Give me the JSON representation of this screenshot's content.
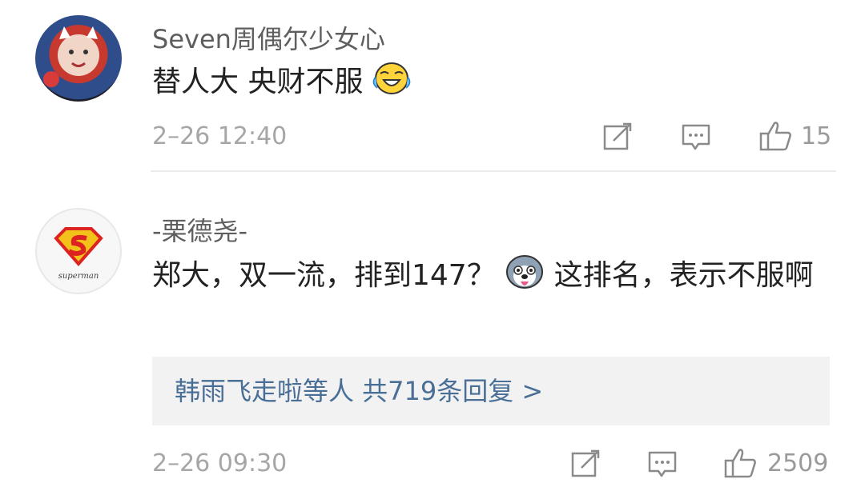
{
  "comments": [
    {
      "username": "Seven周偶尔少女心",
      "text": "替人大 央财不服",
      "emoji": "laugh-cry-emoji",
      "timestamp": "2–26 12:40",
      "likes": "15"
    },
    {
      "username": "-栗德尧-",
      "text_before_emoji": "郑大，双一流，排到147？",
      "text_after_emoji": "这排名，表示不服啊",
      "emoji": "husky-dog-emoji",
      "avatar_label": "superman",
      "replies_summary": "韩雨飞走啦等人 共719条回复 >",
      "timestamp": "2–26 09:30",
      "likes": "2509"
    }
  ],
  "colors": {
    "username": "#5e5e5e",
    "text": "#222222",
    "meta": "#a6a6a6",
    "reply_link": "#4a6f96",
    "reply_bg": "#f2f2f2"
  }
}
